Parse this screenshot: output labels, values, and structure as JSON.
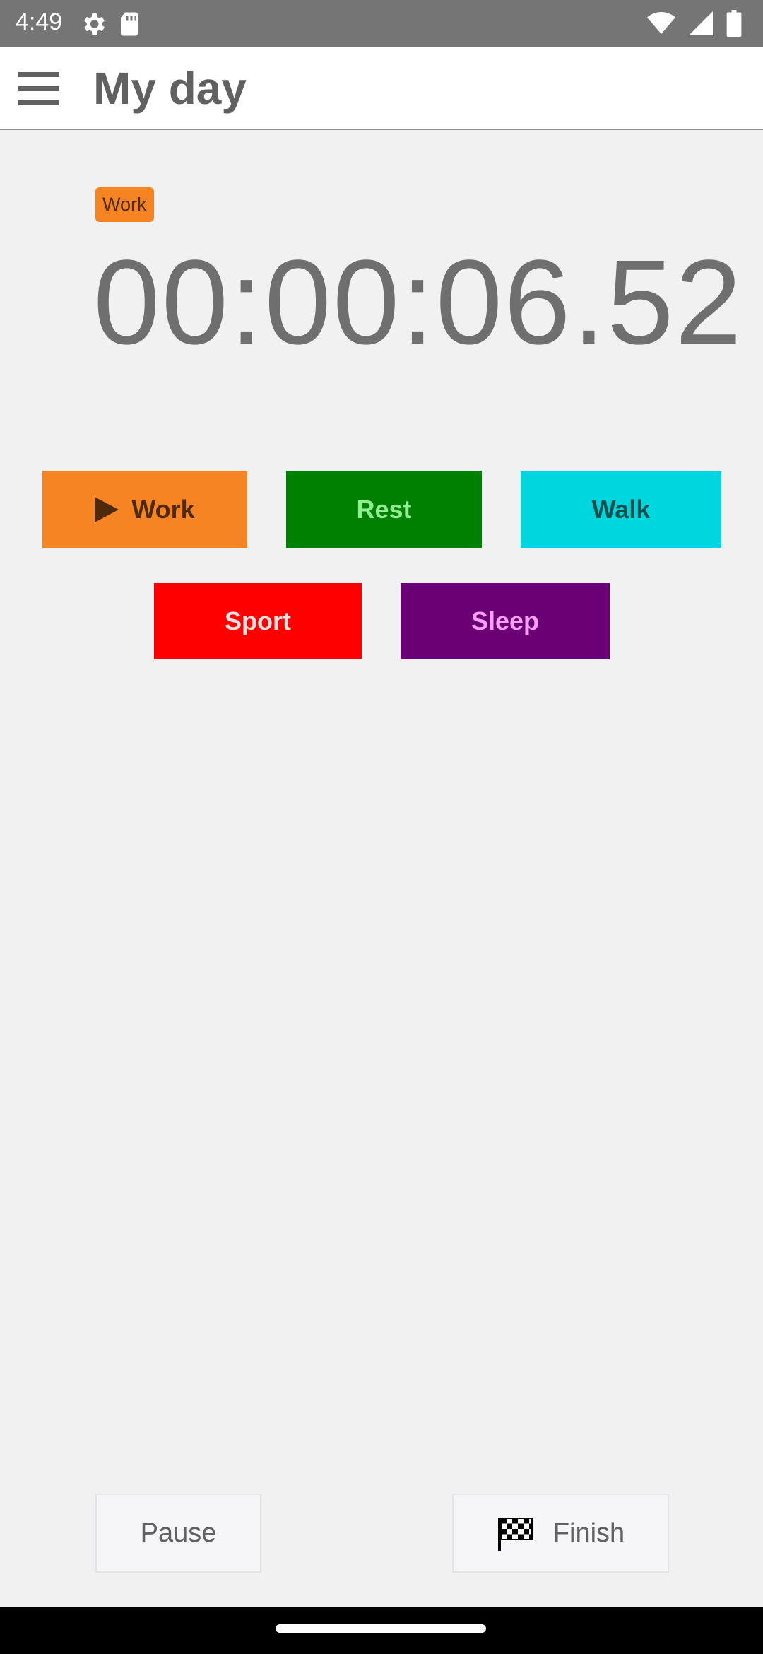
{
  "status_bar": {
    "time": "4:49",
    "icons": [
      "settings-gear-icon",
      "sd-card-icon",
      "wifi-icon",
      "cell-signal-icon",
      "battery-icon"
    ]
  },
  "app_bar": {
    "title": "My day",
    "menu_icon": "hamburger-menu-icon"
  },
  "current_activity": {
    "label": "Work",
    "color": "#f68423"
  },
  "timer": {
    "value": "00:00:06.52"
  },
  "activities": [
    {
      "label": "Work",
      "bg": "#f68423",
      "fg": "#4e2a0b",
      "active": true
    },
    {
      "label": "Rest",
      "bg": "#008000",
      "fg": "#90ee90",
      "active": false
    },
    {
      "label": "Walk",
      "bg": "#00d6de",
      "fg": "#005050",
      "active": false
    },
    {
      "label": "Sport",
      "bg": "#ff0000",
      "fg": "#ffe0e0",
      "active": false
    },
    {
      "label": "Sleep",
      "bg": "#6b0074",
      "fg": "#ffa0ff",
      "active": false
    }
  ],
  "controls": {
    "pause_label": "Pause",
    "finish_label": "Finish",
    "finish_icon": "checkered-flag-icon"
  }
}
